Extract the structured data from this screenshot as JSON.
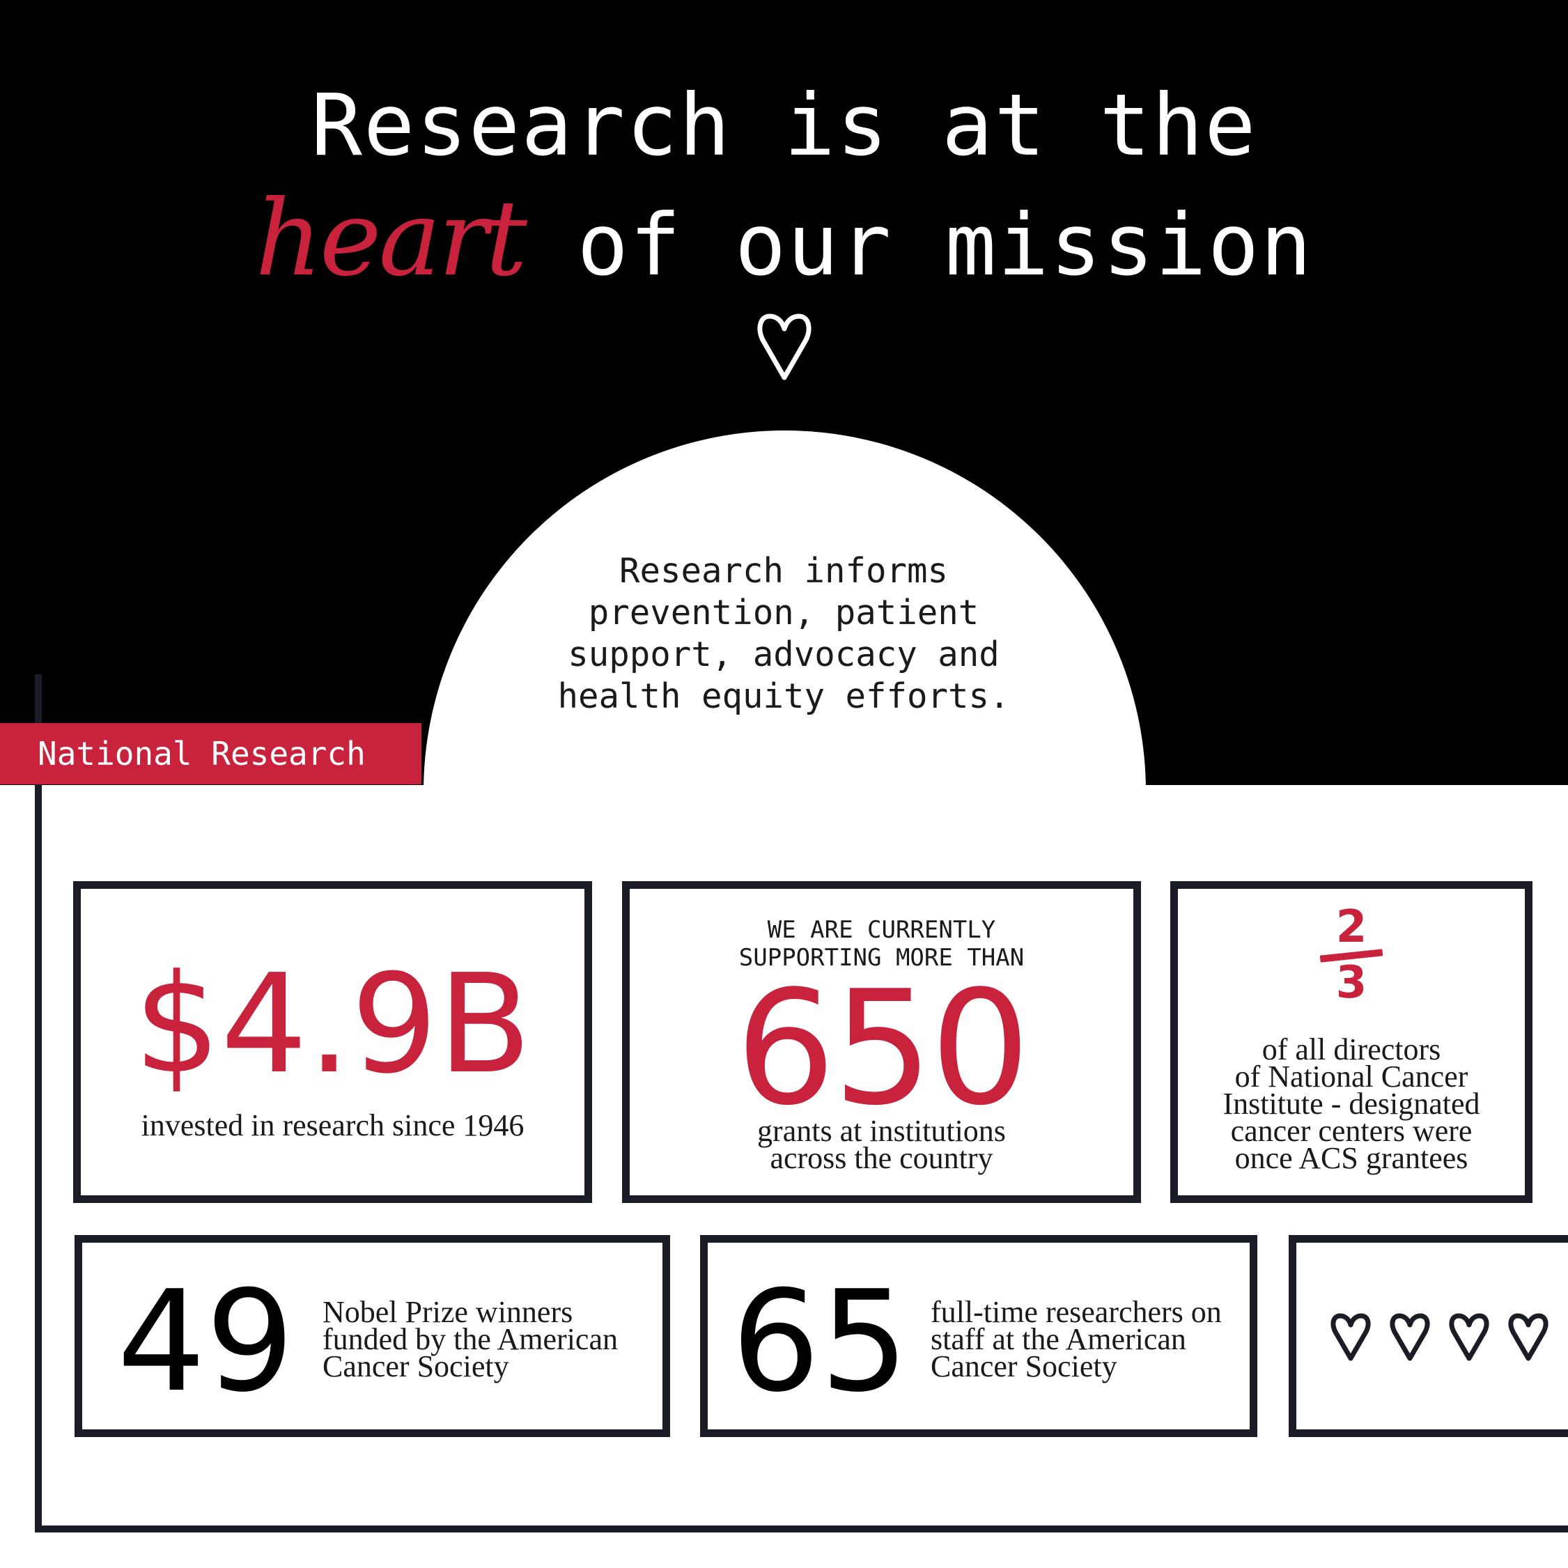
{
  "heading": {
    "line1": "Research is at the",
    "emphasis": "heart",
    "line2_rest": " of our mission"
  },
  "arch_text": "Research informs\nprevention, patient\nsupport, advocacy and\nhealth equity efforts.",
  "section_tag": "National Research",
  "stats": {
    "invested": {
      "value": "$4.9B",
      "caption": "invested in research since 1946"
    },
    "grants": {
      "pre_label_1": "WE ARE CURRENTLY",
      "pre_label_2": "SUPPORTING MORE THAN",
      "value": "650",
      "caption_1": "grants at institutions",
      "caption_2": "across the country"
    },
    "directors": {
      "numerator": "2",
      "denominator": "3",
      "caption_1": "of all directors",
      "caption_2": "of National Cancer",
      "caption_3": "Institute - designated",
      "caption_4": "cancer centers were",
      "caption_5": "once ACS grantees"
    },
    "nobel": {
      "value": "49",
      "caption_1": "Nobel Prize winners",
      "caption_2": "funded by the American",
      "caption_3": "Cancer Society"
    },
    "researchers": {
      "value": "65",
      "caption_1": "full-time researchers on",
      "caption_2": "staff at the American",
      "caption_3": "Cancer Society"
    }
  },
  "icons": {
    "top": "heart-outline-icon",
    "row": [
      "heart-outline-icon",
      "heart-outline-icon",
      "heart-outline-icon",
      "heart-outline-icon"
    ]
  },
  "colors": {
    "accent_red": "#c8223d",
    "black": "#000000",
    "frame": "#1b1d26",
    "white": "#ffffff"
  }
}
